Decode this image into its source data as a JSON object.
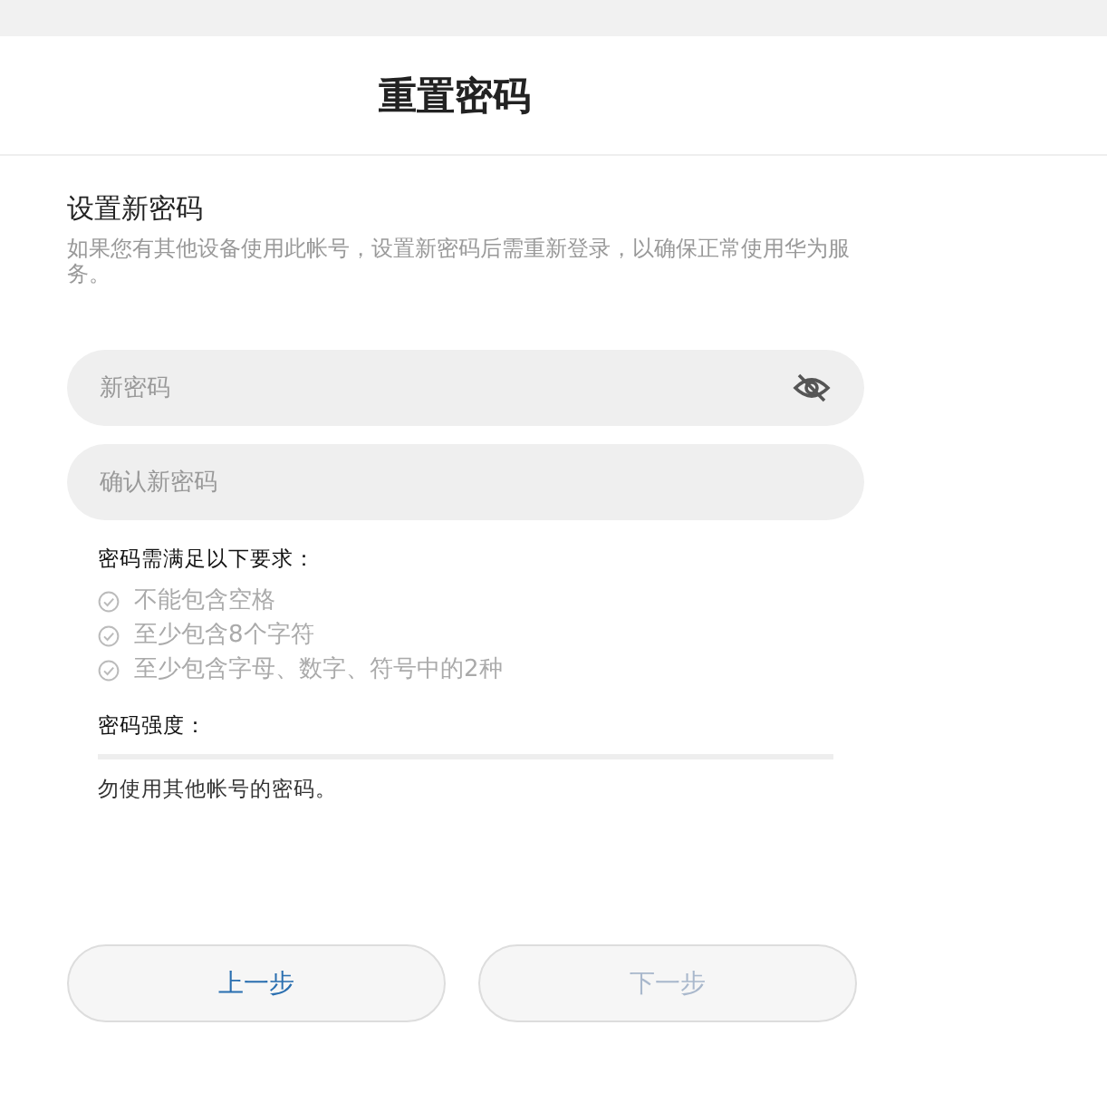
{
  "header": {
    "title": "重置密码"
  },
  "section": {
    "title": "设置新密码",
    "description": "如果您有其他设备使用此帐号，设置新密码后需重新登录，以确保正常使用华为服务。"
  },
  "fields": [
    {
      "placeholder": "新密码",
      "kind": "password"
    },
    {
      "placeholder": "确认新密码",
      "kind": "text"
    }
  ],
  "requirements": {
    "title": "密码需满足以下要求：",
    "items": [
      {
        "label": "不能包含空格",
        "met": false
      },
      {
        "label": "至少包含8个字符",
        "met": false
      },
      {
        "label": "至少包含字母、数字、符号中的2种",
        "met": false
      }
    ]
  },
  "strength": {
    "label": "密码强度："
  },
  "note": "勿使用其他帐号的密码。",
  "buttons": [
    {
      "label": "上一步",
      "disabled": false
    },
    {
      "label": "下一步",
      "disabled": true
    }
  ]
}
